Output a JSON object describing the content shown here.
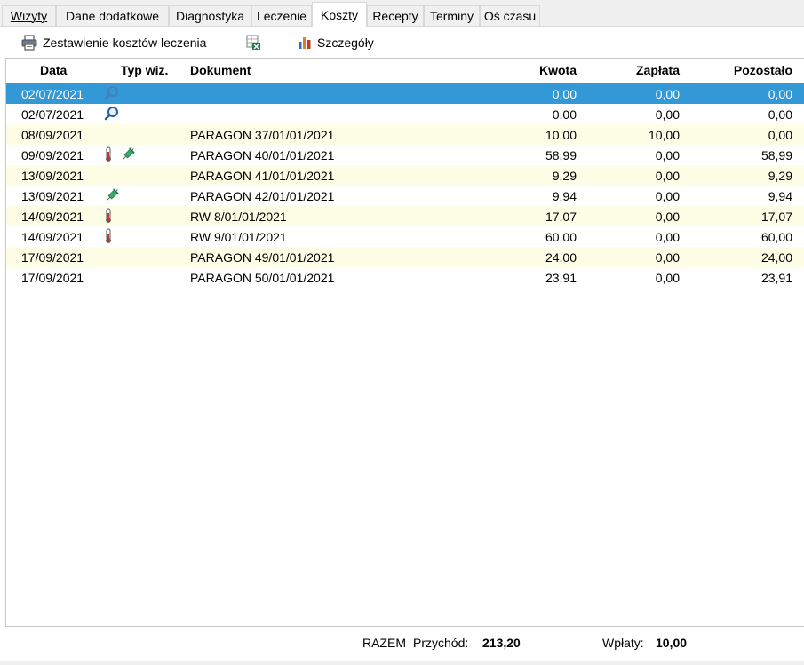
{
  "tabs": [
    {
      "label": "Wizyty",
      "active": false
    },
    {
      "label": "Dane dodatkowe",
      "active": false
    },
    {
      "label": "Diagnostyka",
      "active": false
    },
    {
      "label": "Leczenie",
      "active": false
    },
    {
      "label": "Koszty",
      "active": true
    },
    {
      "label": "Recepty",
      "active": false
    },
    {
      "label": "Terminy",
      "active": false
    },
    {
      "label": "Oś czasu",
      "active": false
    }
  ],
  "toolbar": {
    "print_label": "Zestawienie kosztów leczenia",
    "excel_icon": "excel-export-icon",
    "details_label": "Szczegóły"
  },
  "table": {
    "headers": {
      "date": "Data",
      "type": "Typ wiz.",
      "document": "Dokument",
      "amount": "Kwota",
      "paid": "Zapłata",
      "remaining": "Pozostało"
    },
    "rows": [
      {
        "date": "02/07/2021",
        "icons": [
          "magnifier-icon"
        ],
        "document": "",
        "amount": "0,00",
        "paid": "0,00",
        "remaining": "0,00",
        "selected": true
      },
      {
        "date": "02/07/2021",
        "icons": [
          "magnifier-icon"
        ],
        "document": "",
        "amount": "0,00",
        "paid": "0,00",
        "remaining": "0,00"
      },
      {
        "date": "08/09/2021",
        "icons": [],
        "document": "PARAGON 37/01/01/2021",
        "amount": "10,00",
        "paid": "10,00",
        "remaining": "0,00"
      },
      {
        "date": "09/09/2021",
        "icons": [
          "thermometer-icon",
          "syringe-icon"
        ],
        "document": "PARAGON 40/01/01/2021",
        "amount": "58,99",
        "paid": "0,00",
        "remaining": "58,99"
      },
      {
        "date": "13/09/2021",
        "icons": [],
        "document": "PARAGON 41/01/01/2021",
        "amount": "9,29",
        "paid": "0,00",
        "remaining": "9,29"
      },
      {
        "date": "13/09/2021",
        "icons": [
          "syringe-icon"
        ],
        "document": "PARAGON 42/01/01/2021",
        "amount": "9,94",
        "paid": "0,00",
        "remaining": "9,94"
      },
      {
        "date": "14/09/2021",
        "icons": [
          "thermometer-icon"
        ],
        "document": "RW 8/01/01/2021",
        "amount": "17,07",
        "paid": "0,00",
        "remaining": "17,07"
      },
      {
        "date": "14/09/2021",
        "icons": [
          "thermometer-icon"
        ],
        "document": "RW 9/01/01/2021",
        "amount": "60,00",
        "paid": "0,00",
        "remaining": "60,00"
      },
      {
        "date": "17/09/2021",
        "icons": [],
        "document": "PARAGON 49/01/01/2021",
        "amount": "24,00",
        "paid": "0,00",
        "remaining": "24,00"
      },
      {
        "date": "17/09/2021",
        "icons": [],
        "document": "PARAGON 50/01/01/2021",
        "amount": "23,91",
        "paid": "0,00",
        "remaining": "23,91"
      }
    ]
  },
  "footer": {
    "total_label": "RAZEM",
    "income_label": "Przychód:",
    "income_value": "213,20",
    "payments_label": "Wpłaty:",
    "payments_value": "10,00"
  },
  "colors": {
    "selected_row": "#3399d6",
    "alt_row": "#fefde6"
  }
}
